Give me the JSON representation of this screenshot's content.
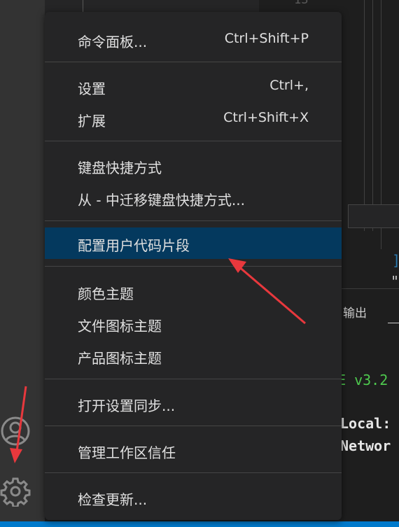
{
  "editor": {
    "line_number": "13",
    "code_bracket": "]",
    "code_quote": "\""
  },
  "panel": {
    "tab_output": "输出",
    "terminal_lines": [
      "E v3.2",
      "Local:",
      "Networ"
    ]
  },
  "menu": {
    "items": [
      {
        "label": "命令面板...",
        "shortcut": "Ctrl+Shift+P"
      },
      {
        "label": "设置",
        "shortcut": "Ctrl+,"
      },
      {
        "label": "扩展",
        "shortcut": "Ctrl+Shift+X"
      },
      {
        "label": "键盘快捷方式",
        "shortcut": ""
      },
      {
        "label": "从 - 中迁移键盘快捷方式...",
        "shortcut": ""
      },
      {
        "label": "配置用户代码片段",
        "shortcut": ""
      },
      {
        "label": "颜色主题",
        "shortcut": ""
      },
      {
        "label": "文件图标主题",
        "shortcut": ""
      },
      {
        "label": "产品图标主题",
        "shortcut": ""
      },
      {
        "label": "打开设置同步...",
        "shortcut": ""
      },
      {
        "label": "管理工作区信任",
        "shortcut": ""
      },
      {
        "label": "检查更新...",
        "shortcut": ""
      }
    ],
    "selected_label": "配置用户代码片段"
  },
  "activity_bar": {
    "icons": [
      "account-icon",
      "gear-icon"
    ]
  },
  "colors": {
    "menu_background": "#252526",
    "selection": "#04395e",
    "annotation_arrow": "#e8383d",
    "status_bar": "#007acc"
  }
}
